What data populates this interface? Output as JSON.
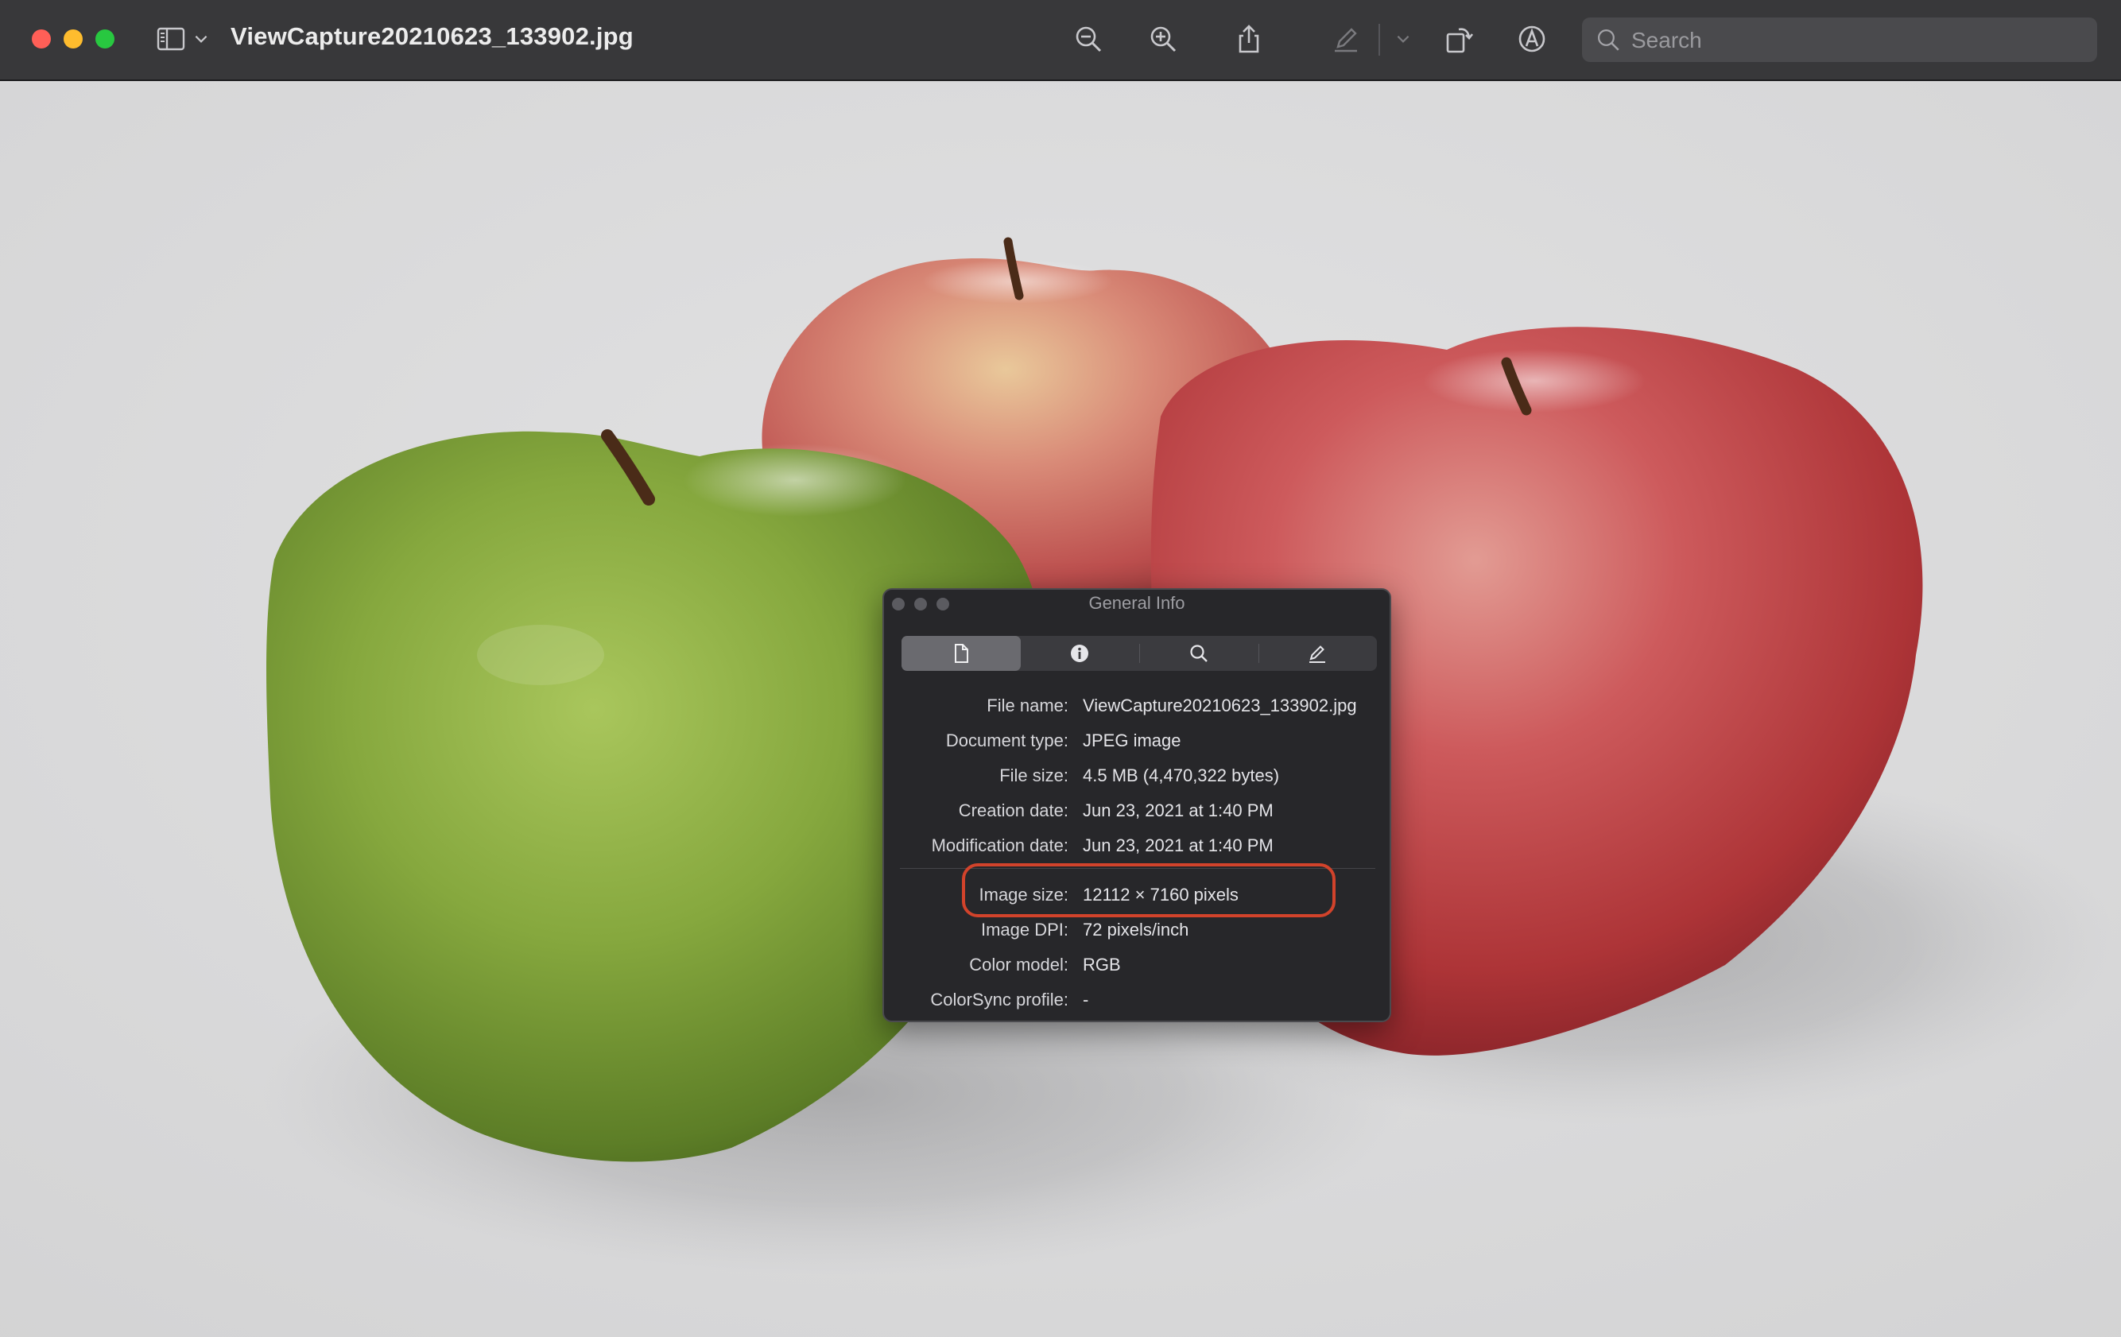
{
  "window": {
    "title": "ViewCapture20210623_133902.jpg"
  },
  "toolbar": {
    "sidebar_icon": "sidebar-icon",
    "sidebar_menu_icon": "chevron-down-icon",
    "zoom_out_icon": "zoom-out-icon",
    "zoom_in_icon": "zoom-in-icon",
    "share_icon": "share-icon",
    "highlight_icon": "pen-icon",
    "highlight_menu_icon": "chevron-down-icon",
    "rotate_icon": "rotate-icon",
    "markup_icon": "markup-icon"
  },
  "search": {
    "placeholder": "Search"
  },
  "info_panel": {
    "title": "General Info",
    "tabs": [
      {
        "icon": "document-icon",
        "active": true
      },
      {
        "icon": "info-icon",
        "active": false
      },
      {
        "icon": "search-icon",
        "active": false
      },
      {
        "icon": "pen-icon",
        "active": false
      }
    ],
    "rows": [
      {
        "label": "File name:",
        "value": "ViewCapture20210623_133902.jpg"
      },
      {
        "label": "Document type:",
        "value": "JPEG image"
      },
      {
        "label": "File size:",
        "value": "4.5 MB (4,470,322 bytes)"
      },
      {
        "label": "Creation date:",
        "value": "Jun 23, 2021 at 1:40 PM"
      },
      {
        "label": "Modification date:",
        "value": "Jun 23, 2021 at 1:40 PM"
      },
      {
        "label": "Image size:",
        "value": "12112 × 7160 pixels"
      },
      {
        "label": "Image DPI:",
        "value": "72 pixels/inch"
      },
      {
        "label": "Color model:",
        "value": "RGB"
      },
      {
        "label": "ColorSync profile:",
        "value": "-"
      }
    ],
    "highlighted_row": "Image size:",
    "highlight_color": "#d2432b"
  },
  "colors": {
    "titlebar": "#38383a",
    "background": "#d9d9da",
    "panel": "#27272a"
  }
}
